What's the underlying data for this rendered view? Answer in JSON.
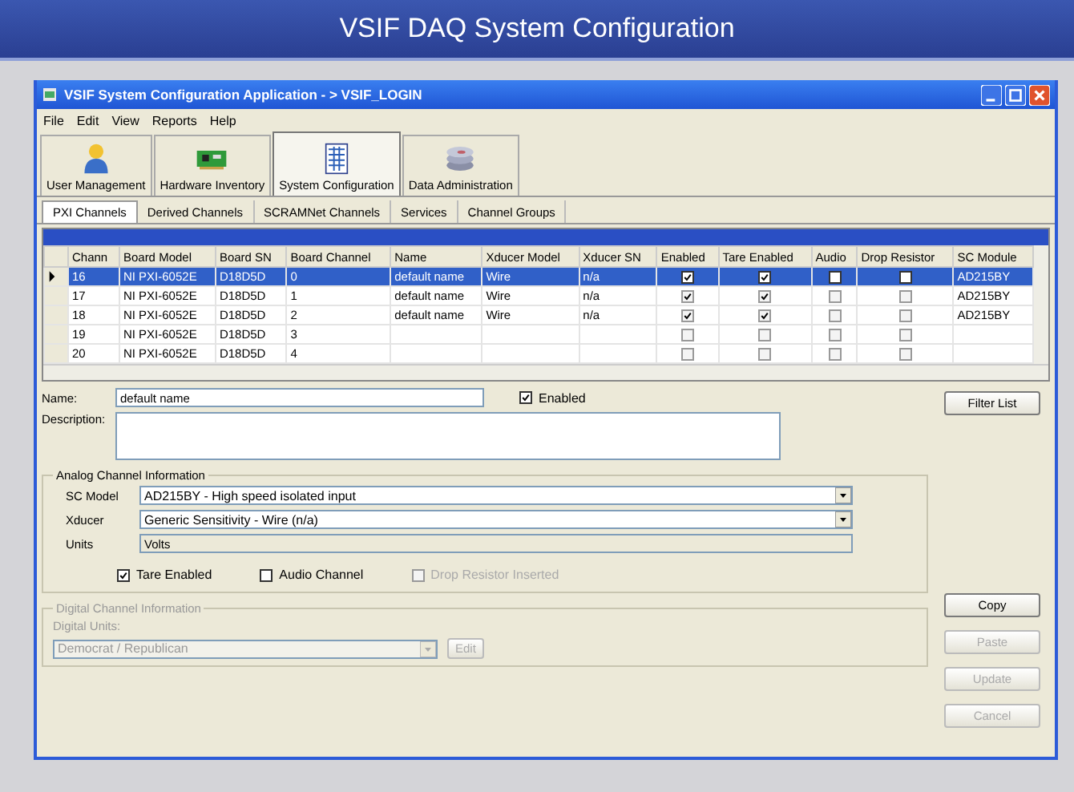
{
  "slide_title": "VSIF DAQ System Configuration",
  "window": {
    "title": "VSIF System Configuration Application - > VSIF_LOGIN"
  },
  "menu": [
    "File",
    "Edit",
    "View",
    "Reports",
    "Help"
  ],
  "toolbar": [
    {
      "label": "User Management",
      "kind": "person",
      "selected": false
    },
    {
      "label": "Hardware Inventory",
      "kind": "board",
      "selected": false
    },
    {
      "label": "System Configuration",
      "kind": "document",
      "selected": true
    },
    {
      "label": "Data Administration",
      "kind": "disks",
      "selected": false
    }
  ],
  "tabs": [
    {
      "label": "PXI Channels",
      "selected": true
    },
    {
      "label": "Derived Channels",
      "selected": false
    },
    {
      "label": "SCRAMNet Channels",
      "selected": false
    },
    {
      "label": "Services",
      "selected": false
    },
    {
      "label": "Channel Groups",
      "selected": false
    }
  ],
  "table": {
    "columns": [
      "Chann",
      "Board Model",
      "Board SN",
      "Board Channel",
      "Name",
      "Xducer Model",
      "Xducer SN",
      "Enabled",
      "Tare Enabled",
      "Audio",
      "Drop Resistor",
      "SC Module"
    ],
    "rows": [
      {
        "selected": true,
        "chan": "16",
        "board_model": "NI PXI-6052E",
        "board_sn": "D18D5D",
        "board_channel": "0",
        "name": "default name",
        "xducer_model": "Wire",
        "xducer_sn": "n/a",
        "enabled": true,
        "tare_enabled": true,
        "audio": false,
        "drop_resistor": false,
        "sc_module": "AD215BY"
      },
      {
        "selected": false,
        "chan": "17",
        "board_model": "NI PXI-6052E",
        "board_sn": "D18D5D",
        "board_channel": "1",
        "name": "default name",
        "xducer_model": "Wire",
        "xducer_sn": "n/a",
        "enabled": true,
        "tare_enabled": true,
        "audio": false,
        "drop_resistor": false,
        "sc_module": "AD215BY"
      },
      {
        "selected": false,
        "chan": "18",
        "board_model": "NI PXI-6052E",
        "board_sn": "D18D5D",
        "board_channel": "2",
        "name": "default name",
        "xducer_model": "Wire",
        "xducer_sn": "n/a",
        "enabled": true,
        "tare_enabled": true,
        "audio": false,
        "drop_resistor": false,
        "sc_module": "AD215BY"
      },
      {
        "selected": false,
        "chan": "19",
        "board_model": "NI PXI-6052E",
        "board_sn": "D18D5D",
        "board_channel": "3",
        "enabled": false,
        "tare_enabled": false,
        "audio": false,
        "drop_resistor": false
      },
      {
        "selected": false,
        "chan": "20",
        "board_model": "NI PXI-6052E",
        "board_sn": "D18D5D",
        "board_channel": "4",
        "enabled": false,
        "tare_enabled": false,
        "audio": false,
        "drop_resistor": false
      }
    ]
  },
  "form": {
    "name_label": "Name:",
    "name_value": "default name",
    "enabled_label": "Enabled",
    "enabled": true,
    "description_label": "Description:",
    "filter_button": "Filter List"
  },
  "analog": {
    "legend": "Analog Channel Information",
    "sc_model_label": "SC Model",
    "sc_model_value": "AD215BY - High speed isolated input",
    "xducer_label": "Xducer",
    "xducer_value": "Generic Sensitivity - Wire (n/a)",
    "units_label": "Units",
    "units_value": "Volts",
    "checks": [
      {
        "label": "Tare Enabled",
        "checked": true,
        "disabled": false
      },
      {
        "label": "Audio Channel",
        "checked": false,
        "disabled": false
      },
      {
        "label": "Drop Resistor Inserted",
        "checked": false,
        "disabled": true
      }
    ]
  },
  "digital": {
    "legend": "Digital Channel Information",
    "units_label": "Digital Units:",
    "units_value": "Democrat / Republican",
    "edit_button": "Edit",
    "disabled": true
  },
  "side_buttons": [
    {
      "label": "Copy",
      "disabled": false
    },
    {
      "label": "Paste",
      "disabled": true
    },
    {
      "label": "Update",
      "disabled": true
    },
    {
      "label": "Cancel",
      "disabled": true
    }
  ]
}
